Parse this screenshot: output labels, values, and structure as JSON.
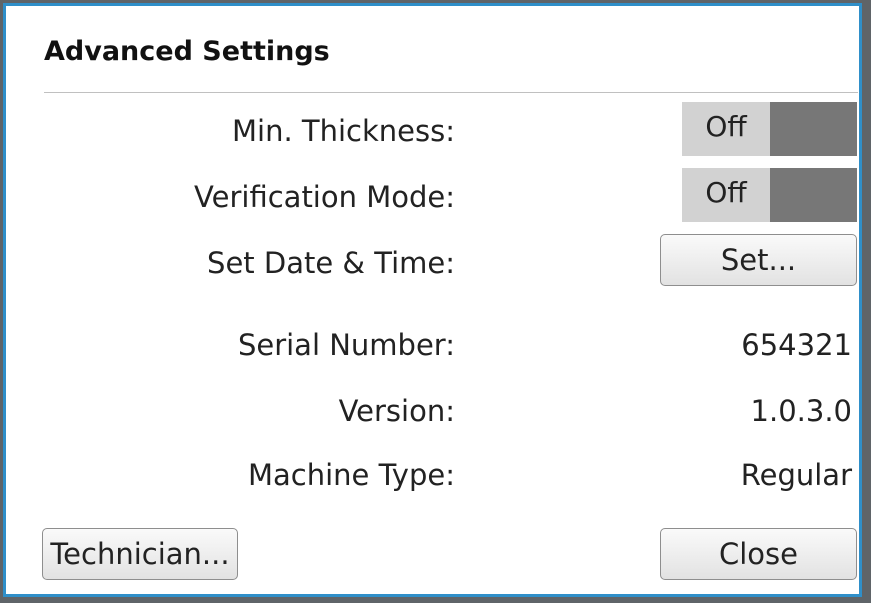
{
  "dialog": {
    "title": "Advanced Settings"
  },
  "settings": {
    "min_thickness": {
      "label": "Min. Thickness:",
      "value": "Off"
    },
    "verification_mode": {
      "label": "Verification Mode:",
      "value": "Off"
    },
    "set_date_time": {
      "label": "Set Date & Time:",
      "button_label": "Set..."
    }
  },
  "info": {
    "serial_number": {
      "label": "Serial Number:",
      "value": "654321"
    },
    "version": {
      "label": "Version:",
      "value": "1.0.3.0"
    },
    "machine_type": {
      "label": "Machine Type:",
      "value": "Regular"
    }
  },
  "footer": {
    "technician_label": "Technician...",
    "close_label": "Close"
  },
  "colors": {
    "frame_accent": "#2f8fc9",
    "toggle_off_text_bg": "#d2d2d2",
    "toggle_off_knob": "#777777"
  }
}
